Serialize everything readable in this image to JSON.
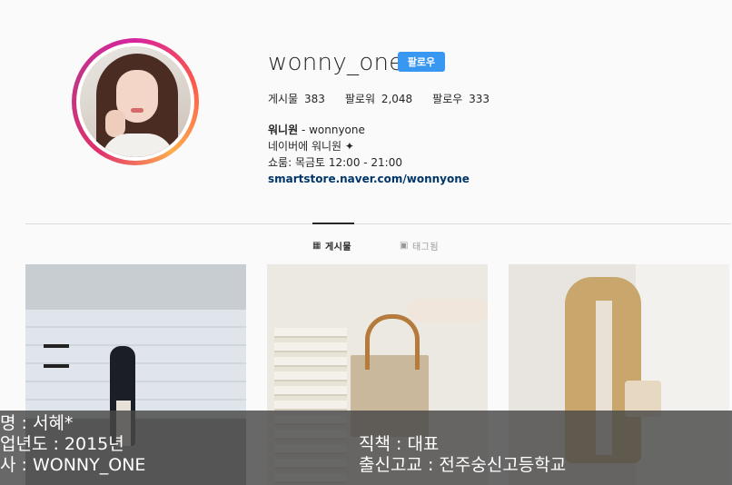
{
  "profile": {
    "username": "wonny_one",
    "follow_label": "팔로우",
    "stats": [
      {
        "label": "게시물",
        "value": "383"
      },
      {
        "label": "팔로워",
        "value": "2,048"
      },
      {
        "label": "팔로우",
        "value": "333"
      }
    ],
    "bio": {
      "name": "워니원",
      "handle": " - wonnyone",
      "line2": "네이버에 워니원 ✦",
      "line3": "쇼룸: 목금토 12:00 - 21:00",
      "link": "smartstore.naver.com/wonnyone"
    }
  },
  "tabs": {
    "posts": {
      "icon": "▦",
      "label": "게시물"
    },
    "tagged": {
      "icon": "▣",
      "label": "태그됨"
    }
  },
  "overlay": {
    "name": "명 : 서혜*",
    "founded": "업년도 : 2015년",
    "company": "사 : WONNY_ONE",
    "role": "직책 : 대표",
    "origin": "출신고교 : 전주숭신고등학교"
  },
  "colors": {
    "follow_button": "#3897f0",
    "background": "#fafafa",
    "overlay": "#484848"
  }
}
